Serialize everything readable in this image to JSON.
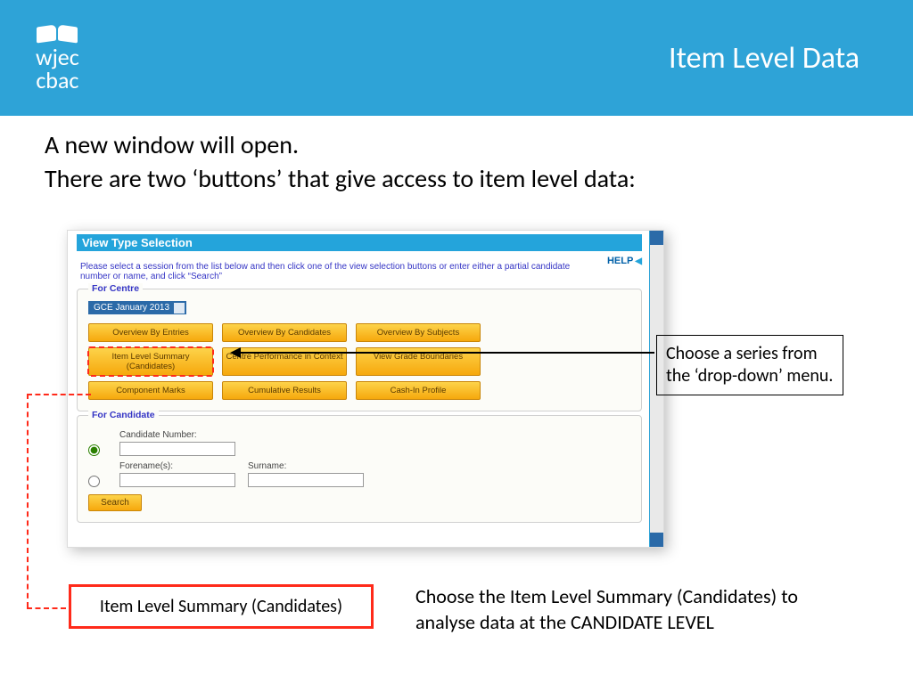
{
  "banner": {
    "logo_top": "wjec",
    "logo_bottom": "cbac",
    "title": "Item Level Data"
  },
  "intro": {
    "line1": "A new window will open.",
    "line2": "There are two ‘buttons’ that give access to item level data:"
  },
  "shot": {
    "header": "View Type Selection",
    "help": "HELP",
    "instruction": "Please select a session from the list below and then click one of the view selection buttons or enter either a partial candidate number or name, and click “Search”",
    "panel_centre": {
      "title": "For Centre",
      "series": "GCE January 2013",
      "buttons": [
        "Overview By Entries",
        "Overview By Candidates",
        "Overview By Subjects",
        "Item Level Summary (Candidates)",
        "Centre Performance in Context",
        "View Grade Boundaries",
        "Component Marks",
        "Cumulative Results",
        "Cash-In Profile"
      ]
    },
    "panel_candidate": {
      "title": "For Candidate",
      "cand_no": "Candidate Number:",
      "forename": "Forename(s):",
      "surname": "Surname:",
      "search": "Search"
    }
  },
  "callouts": {
    "dropdown": "Choose a series from the ‘drop-down’ menu.",
    "item_level_box": "Item Level Summary (Candidates)",
    "explain": "Choose the Item Level Summary (Candidates) to analyse data at the CANDIDATE LEVEL"
  }
}
